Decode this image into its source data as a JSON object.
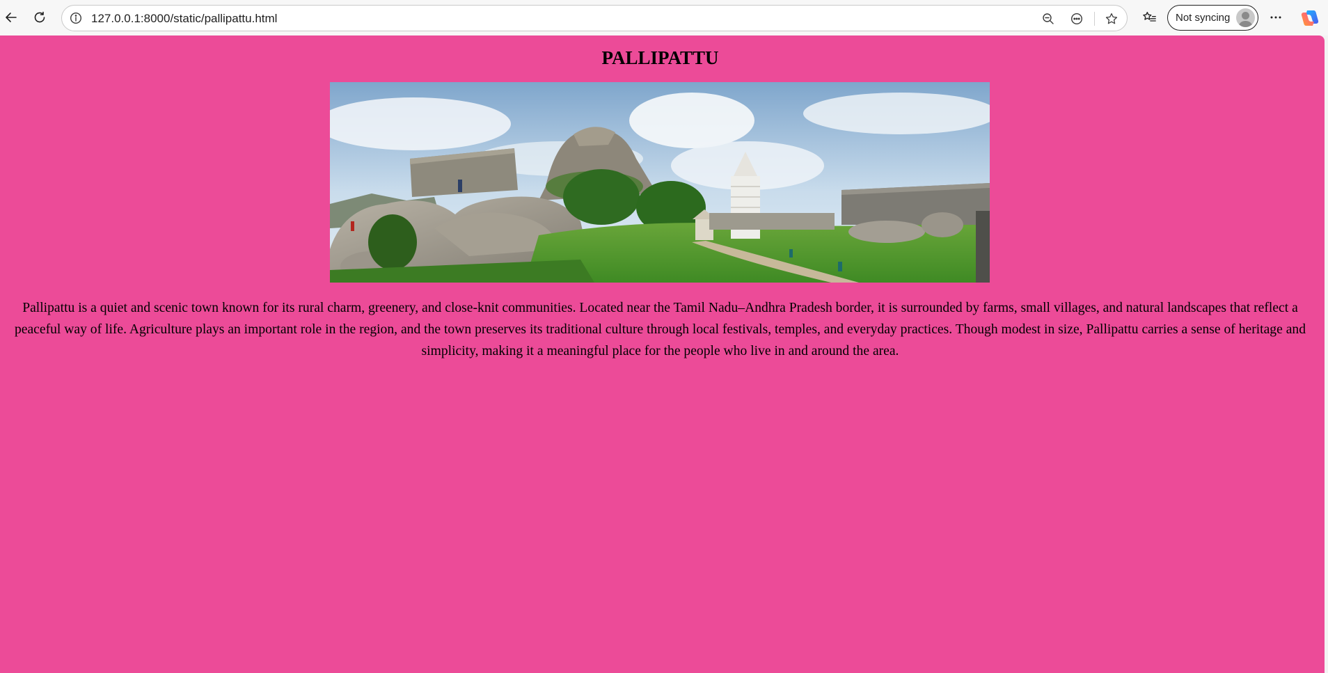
{
  "browser": {
    "url": "127.0.0.1:8000/static/pallipattu.html",
    "sync_label": "Not syncing",
    "icons": {
      "back": "back-arrow-icon",
      "reload": "reload-icon",
      "site_info": "info-icon",
      "zoom": "zoom-out-icon",
      "more_page": "page-actions-icon",
      "favorite": "star-icon",
      "favorites_list": "favorites-list-icon",
      "menu": "more-dots-icon",
      "copilot": "copilot-icon"
    }
  },
  "page": {
    "background_color": "#ec4b98",
    "title": "PALLIPATTU",
    "description": "Pallipattu is a quiet and scenic town known for its rural charm, greenery, and close-knit communities. Located near the Tamil Nadu–Andhra Pradesh border, it is surrounded by farms, small villages, and natural landscapes that reflect a peaceful way of life. Agriculture plays an important role in the region, and the town preserves its traditional culture through local festivals, temples, and everyday practices. Though modest in size, Pallipattu carries a sense of heritage and simplicity, making it a meaningful place for the people who live in and around the area."
  }
}
